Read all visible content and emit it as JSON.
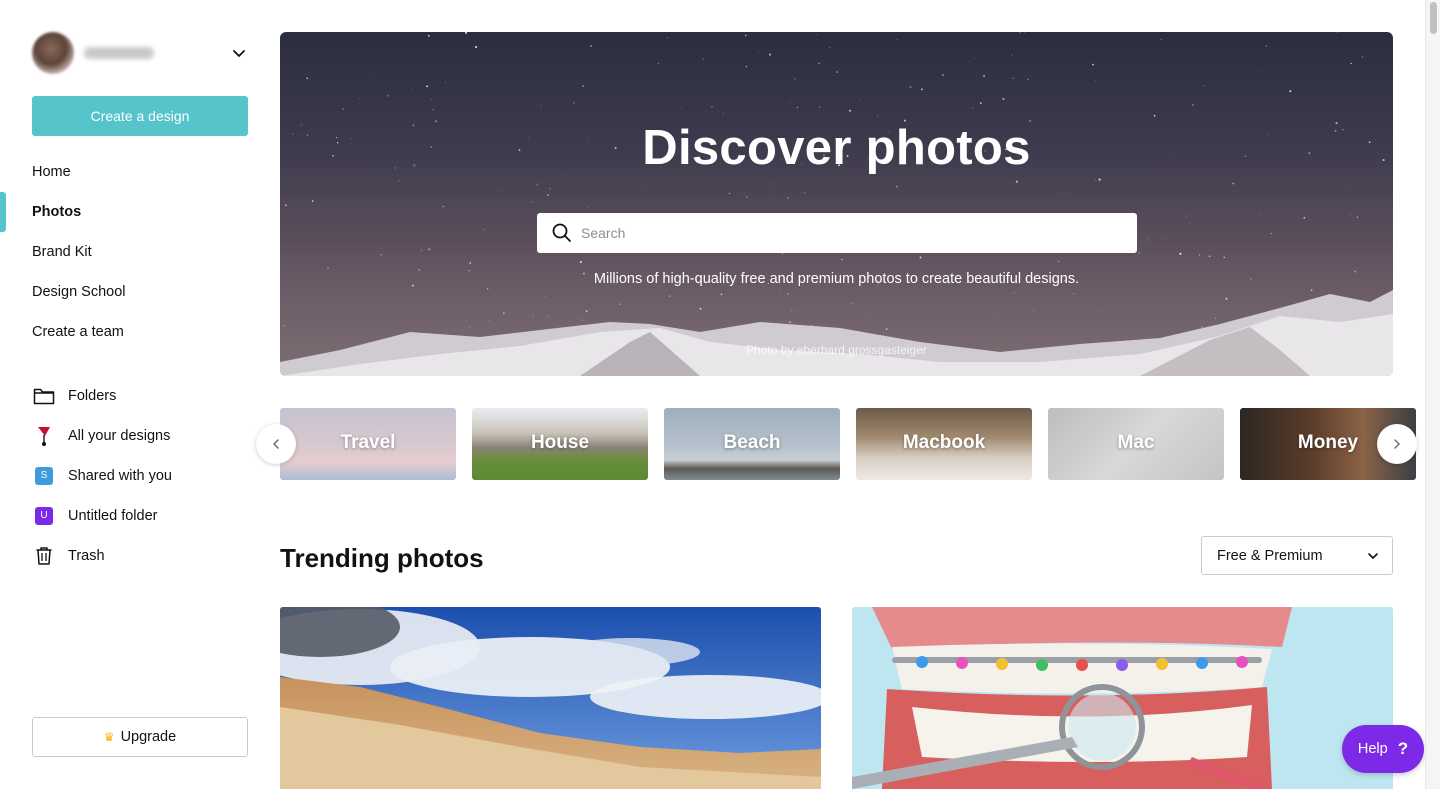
{
  "account": {
    "icon": "chevron-down-icon"
  },
  "sidebar": {
    "create_label": "Create a design",
    "nav": [
      {
        "label": "Home"
      },
      {
        "label": "Photos",
        "active": true
      },
      {
        "label": "Brand Kit"
      },
      {
        "label": "Design School"
      },
      {
        "label": "Create a team"
      }
    ],
    "folders": [
      {
        "label": "Folders",
        "icon": "folder-icon"
      },
      {
        "label": "All your designs",
        "icon": "designs-icon"
      },
      {
        "label": "Shared with you",
        "badge": "S"
      },
      {
        "label": "Untitled folder",
        "badge": "U"
      },
      {
        "label": "Trash",
        "icon": "trash-icon"
      }
    ],
    "upgrade_label": "Upgrade",
    "accent_color": "#56c5cb"
  },
  "hero": {
    "title": "Discover photos",
    "search_placeholder": "Search",
    "subtitle": "Millions of high-quality free and premium photos to create beautiful designs.",
    "credit": "Photo by eberhard grossgasteiger"
  },
  "categories": [
    {
      "label": "Travel"
    },
    {
      "label": "House"
    },
    {
      "label": "Beach"
    },
    {
      "label": "Macbook"
    },
    {
      "label": "Mac"
    },
    {
      "label": "Money"
    }
  ],
  "trending": {
    "title": "Trending photos",
    "filter_value": "Free & Premium"
  },
  "help": {
    "label": "Help",
    "icon": "?",
    "color": "#7d2ae8"
  }
}
